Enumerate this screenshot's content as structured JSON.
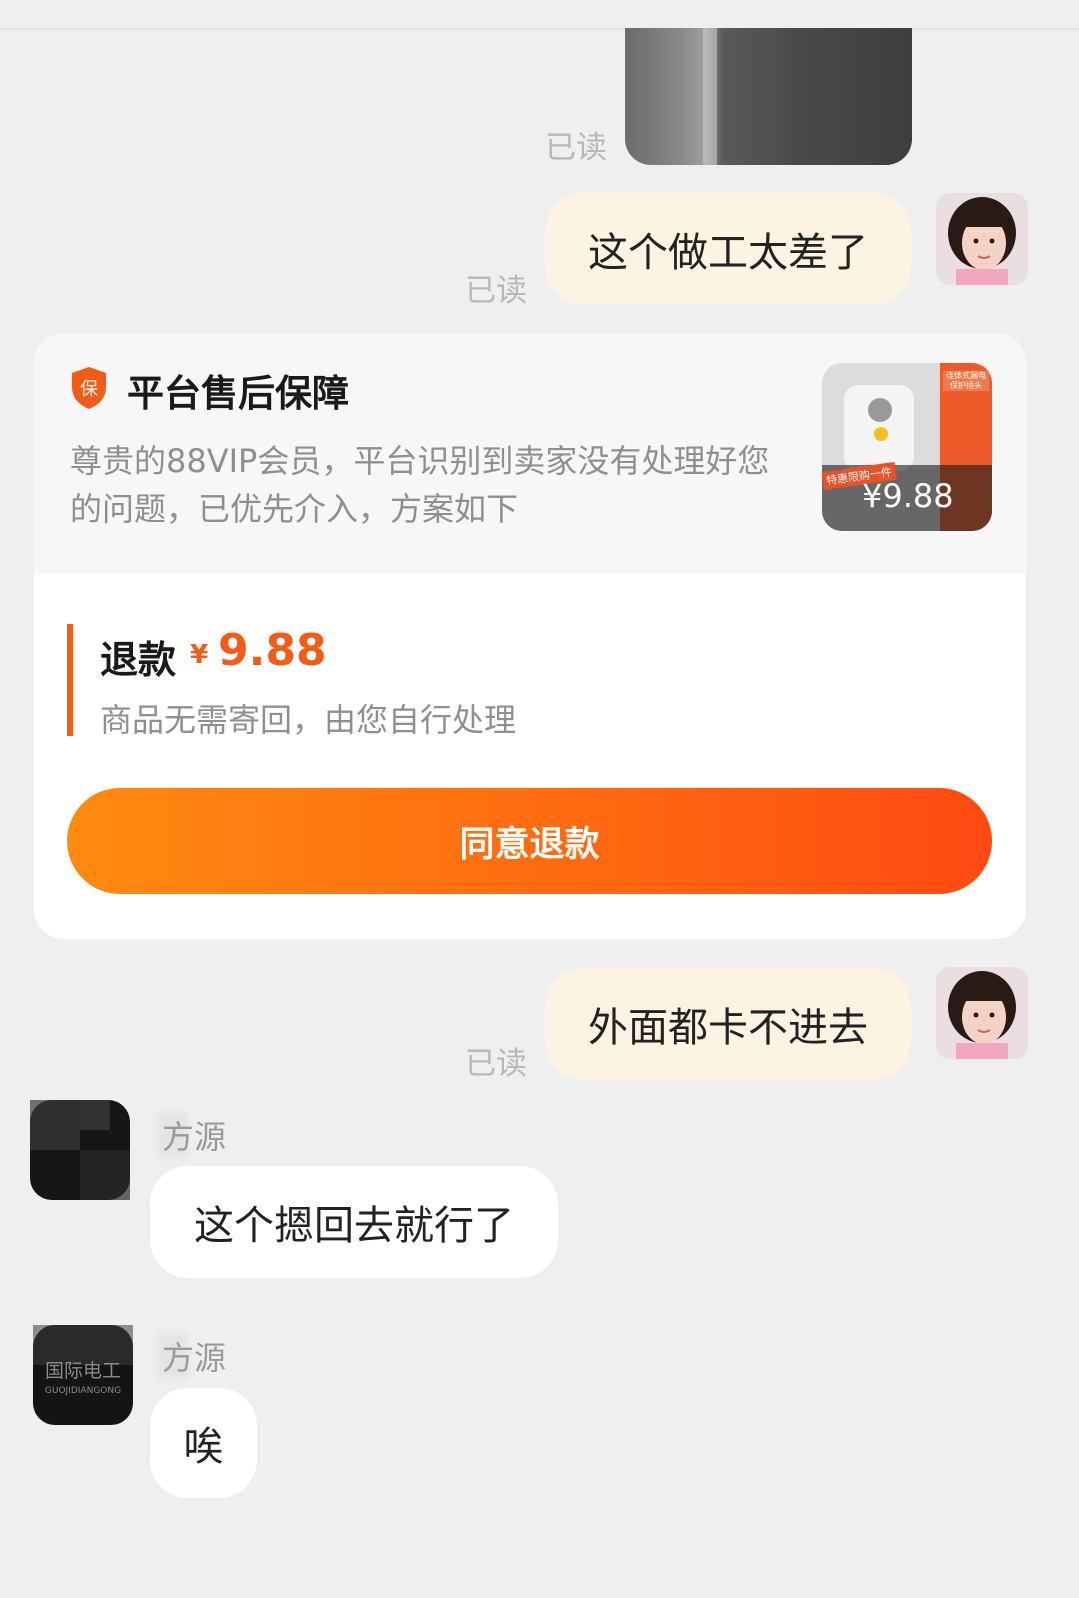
{
  "read_label": "已读",
  "messages_out": [
    {
      "text": "这个做工太差了"
    },
    {
      "text": "外面都卡不进去"
    }
  ],
  "card": {
    "badge_char": "保",
    "title": "平台售后保障",
    "description": "尊贵的88VIP会员，平台识别到卖家没有处理好您的问题，已优先介入，方案如下",
    "thumbnail": {
      "tag": "连体式漏电保护插头",
      "promo": "特惠限购一件",
      "price": "¥9.88"
    },
    "refund": {
      "label": "退款",
      "currency": "¥",
      "amount": "9.88",
      "note": "商品无需寄回，由您自行处理"
    },
    "agree_button": "同意退款"
  },
  "seller": {
    "name": "方源",
    "logo_line1": "国际电工",
    "logo_line2": "GUOJIDIANGONG"
  },
  "messages_in": [
    {
      "text": "这个摁回去就行了"
    },
    {
      "text": "唉"
    }
  ],
  "colors": {
    "accent": "#f25c17",
    "bubble_out": "#fdf3e3",
    "bubble_in": "#ffffff",
    "background": "#efefef"
  }
}
